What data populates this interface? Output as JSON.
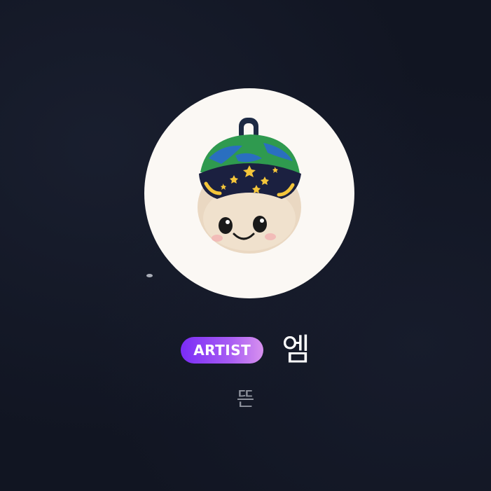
{
  "profile": {
    "avatar_icon": "plush-toy-avatar",
    "badge_label": "ARTIST",
    "name": "엠",
    "subname": "뜬"
  },
  "colors": {
    "background": "#111522",
    "avatar_bg": "#fbf8f4",
    "badge_gradient_start": "#7a2cf6",
    "badge_gradient_end": "#d891ef",
    "name_text": "#ffffff",
    "subname_text": "#8d919c"
  }
}
